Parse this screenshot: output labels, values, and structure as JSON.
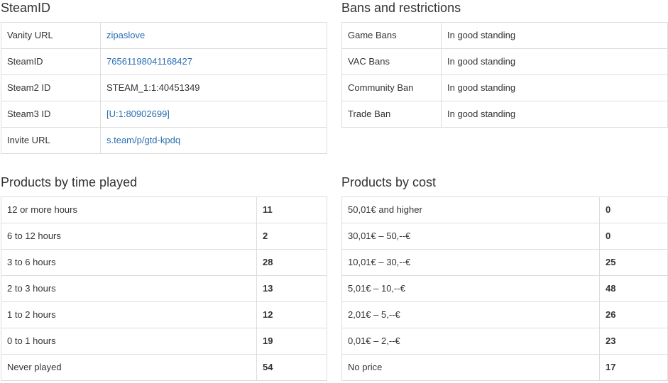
{
  "steamid": {
    "title": "SteamID",
    "rows": [
      {
        "label": "Vanity URL",
        "value": "zipaslove"
      },
      {
        "label": "SteamID",
        "value": "76561198041168427"
      },
      {
        "label": "Steam2 ID",
        "value": "STEAM_1:1:40451349"
      },
      {
        "label": "Steam3 ID",
        "value": "[U:1:80902699]"
      },
      {
        "label": "Invite URL",
        "value": "s.team/p/gtd-kpdq"
      }
    ]
  },
  "bans": {
    "title": "Bans and restrictions",
    "rows": [
      {
        "label": "Game Bans",
        "value": "In good standing"
      },
      {
        "label": "VAC Bans",
        "value": "In good standing"
      },
      {
        "label": "Community Ban",
        "value": "In good standing"
      },
      {
        "label": "Trade Ban",
        "value": "In good standing"
      }
    ]
  },
  "time_played": {
    "title": "Products by time played",
    "rows": [
      {
        "label": "12 or more hours",
        "count": "11"
      },
      {
        "label": "6 to 12 hours",
        "count": "2"
      },
      {
        "label": "3 to 6 hours",
        "count": "28"
      },
      {
        "label": "2 to 3 hours",
        "count": "13"
      },
      {
        "label": "1 to 2 hours",
        "count": "12"
      },
      {
        "label": "0 to 1 hours",
        "count": "19"
      },
      {
        "label": "Never played",
        "count": "54"
      }
    ]
  },
  "cost": {
    "title": "Products by cost",
    "rows": [
      {
        "label": "50,01€ and higher",
        "count": "0"
      },
      {
        "label": "30,01€ – 50,--€",
        "count": "0"
      },
      {
        "label": "10,01€ – 30,--€",
        "count": "25"
      },
      {
        "label": "5,01€ – 10,--€",
        "count": "48"
      },
      {
        "label": "2,01€ – 5,--€",
        "count": "26"
      },
      {
        "label": "0,01€ – 2,--€",
        "count": "23"
      },
      {
        "label": "No price",
        "count": "17"
      }
    ]
  },
  "colors": {
    "link": "#2a6fb0",
    "border": "#dddddd",
    "text": "#333333"
  }
}
